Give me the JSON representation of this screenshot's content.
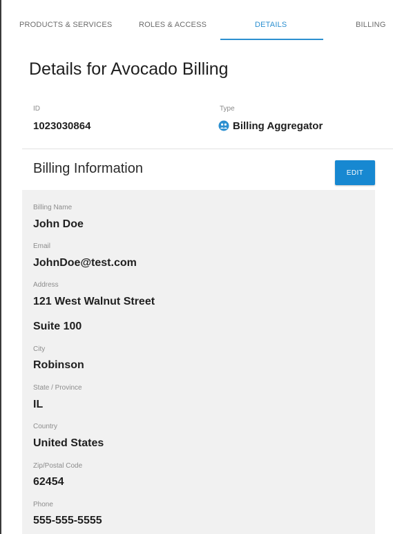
{
  "tabs": [
    {
      "label": "PRODUCTS & SERVICES",
      "active": false
    },
    {
      "label": "ROLES & ACCESS",
      "active": false
    },
    {
      "label": "DETAILS",
      "active": true
    },
    {
      "label": "BILLING",
      "active": false
    }
  ],
  "page": {
    "title": "Details for Avocado Billing"
  },
  "meta": {
    "id_label": "ID",
    "id_value": "1023030864",
    "type_label": "Type",
    "type_value": "Billing Aggregator",
    "type_icon": "billing-aggregator-icon"
  },
  "billing": {
    "section_title": "Billing Information",
    "edit_label": "EDIT",
    "fields": {
      "billing_name_label": "Billing Name",
      "billing_name": "John Doe",
      "email_label": "Email",
      "email": "JohnDoe@test.com",
      "address_label": "Address",
      "address_line1": "121 West Walnut Street",
      "address_line2": "Suite 100",
      "city_label": "City",
      "city": "Robinson",
      "state_label": "State / Province",
      "state": "IL",
      "country_label": "Country",
      "country": "United States",
      "zip_label": "Zip/Postal Code",
      "zip": "62454",
      "phone_label": "Phone",
      "phone": "555-555-5555"
    }
  },
  "colors": {
    "accent": "#2b8fd0",
    "button": "#1788d1",
    "panel": "#f1f1f1"
  }
}
